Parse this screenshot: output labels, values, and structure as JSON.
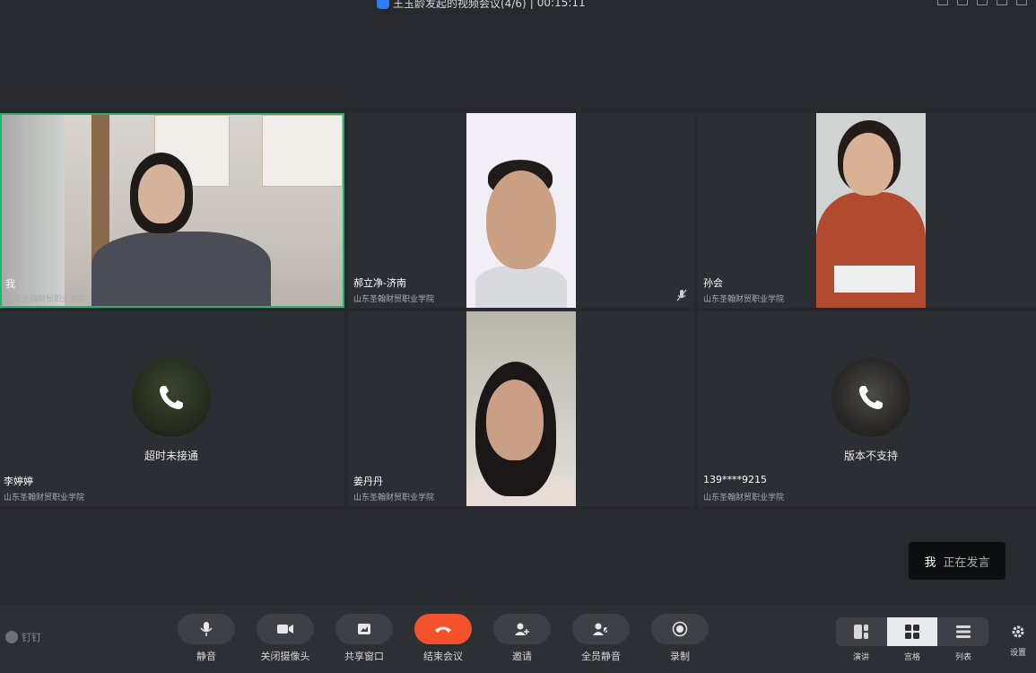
{
  "window": {
    "title": "王玉龄发起的视频会议(4/6)",
    "separator": "|",
    "duration": "00:15:11"
  },
  "participants": [
    {
      "name": "我",
      "org": "山东圣翰财贸职业学院",
      "state": "video",
      "active": true
    },
    {
      "name": "郝立净-济南",
      "org": "山东圣翰财贸职业学院",
      "state": "video",
      "mic_muted": true
    },
    {
      "name": "孙会",
      "org": "山东圣翰财贸职业学院",
      "state": "video"
    },
    {
      "name": "李婷婷",
      "org": "山东圣翰财贸职业学院",
      "state": "calling",
      "status": "超时未接通"
    },
    {
      "name": "姜丹丹",
      "org": "山东圣翰财贸职业学院",
      "state": "video"
    },
    {
      "name": "139****9215",
      "org": "山东圣翰财贸职业学院",
      "state": "calling",
      "status": "版本不支持"
    }
  ],
  "speaking_toast": {
    "who": "我",
    "status": "正在发言"
  },
  "brand": {
    "name": "钉钉"
  },
  "toolbar": {
    "mute": "静音",
    "camera_off": "关闭摄像头",
    "share_window": "共享窗口",
    "end_meeting": "结束会议",
    "invite": "邀请",
    "mute_all": "全员静音",
    "record": "录制"
  },
  "layout": {
    "options": [
      "演讲",
      "宫格",
      "列表"
    ],
    "selected": "宫格"
  },
  "settings": {
    "label": "设置"
  },
  "colors": {
    "background": "#27292e",
    "active_border": "#1fb86b",
    "end_button": "#f4522a",
    "title_shield": "#2f7cf6"
  }
}
